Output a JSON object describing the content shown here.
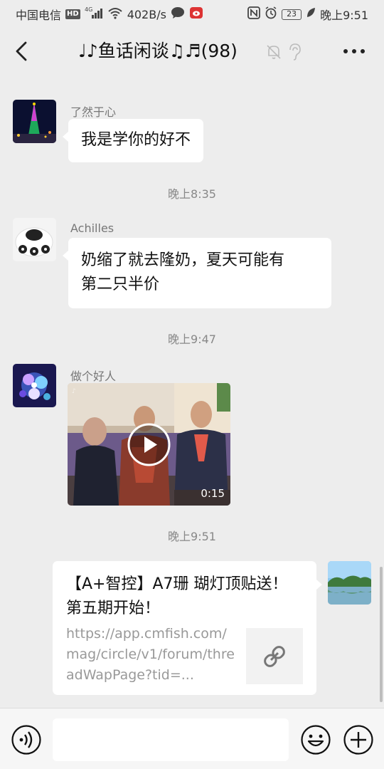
{
  "status_bar": {
    "carrier": "中国电信",
    "network_badge": "HD",
    "signal_label": "4G",
    "speed": "402B/s",
    "battery": "23",
    "time": "晚上9:51",
    "icons": [
      "signal-icon",
      "wifi-icon",
      "chat-bubble-icon",
      "weibo-icon",
      "nfc-icon",
      "alarm-icon",
      "leaf-icon"
    ]
  },
  "nav": {
    "title": "♩♪鱼话闲谈♫♬(98)",
    "icons": [
      "back-chevron-icon",
      "mute-bell-icon",
      "ear-icon",
      "more-dots-icon"
    ]
  },
  "messages": [
    {
      "sender": "了然于心",
      "text": "我是学你的好不"
    },
    {
      "time": "晚上8:35"
    },
    {
      "sender": "Achilles",
      "line1": "奶缩了就去隆奶，夏天可能有",
      "line2": "第二只半价"
    },
    {
      "time": "晚上9:47"
    },
    {
      "sender": "做个好人",
      "video_duration": "0:15"
    },
    {
      "time": "晚上9:51"
    },
    {
      "link_title": "【A+智控】A7珊 瑚灯顶贴送！第五期开始！",
      "link_url": "https://app.cmfish.com/mag/circle/v1/forum/threadWapPage?tid=..."
    }
  ],
  "input_bar": {
    "placeholder": "",
    "icons": [
      "voice-icon",
      "emoji-icon",
      "plus-icon"
    ]
  },
  "colors": {
    "background": "#ededed",
    "bubble": "#ffffff",
    "time_text": "#888888",
    "sender_text": "#777777"
  }
}
